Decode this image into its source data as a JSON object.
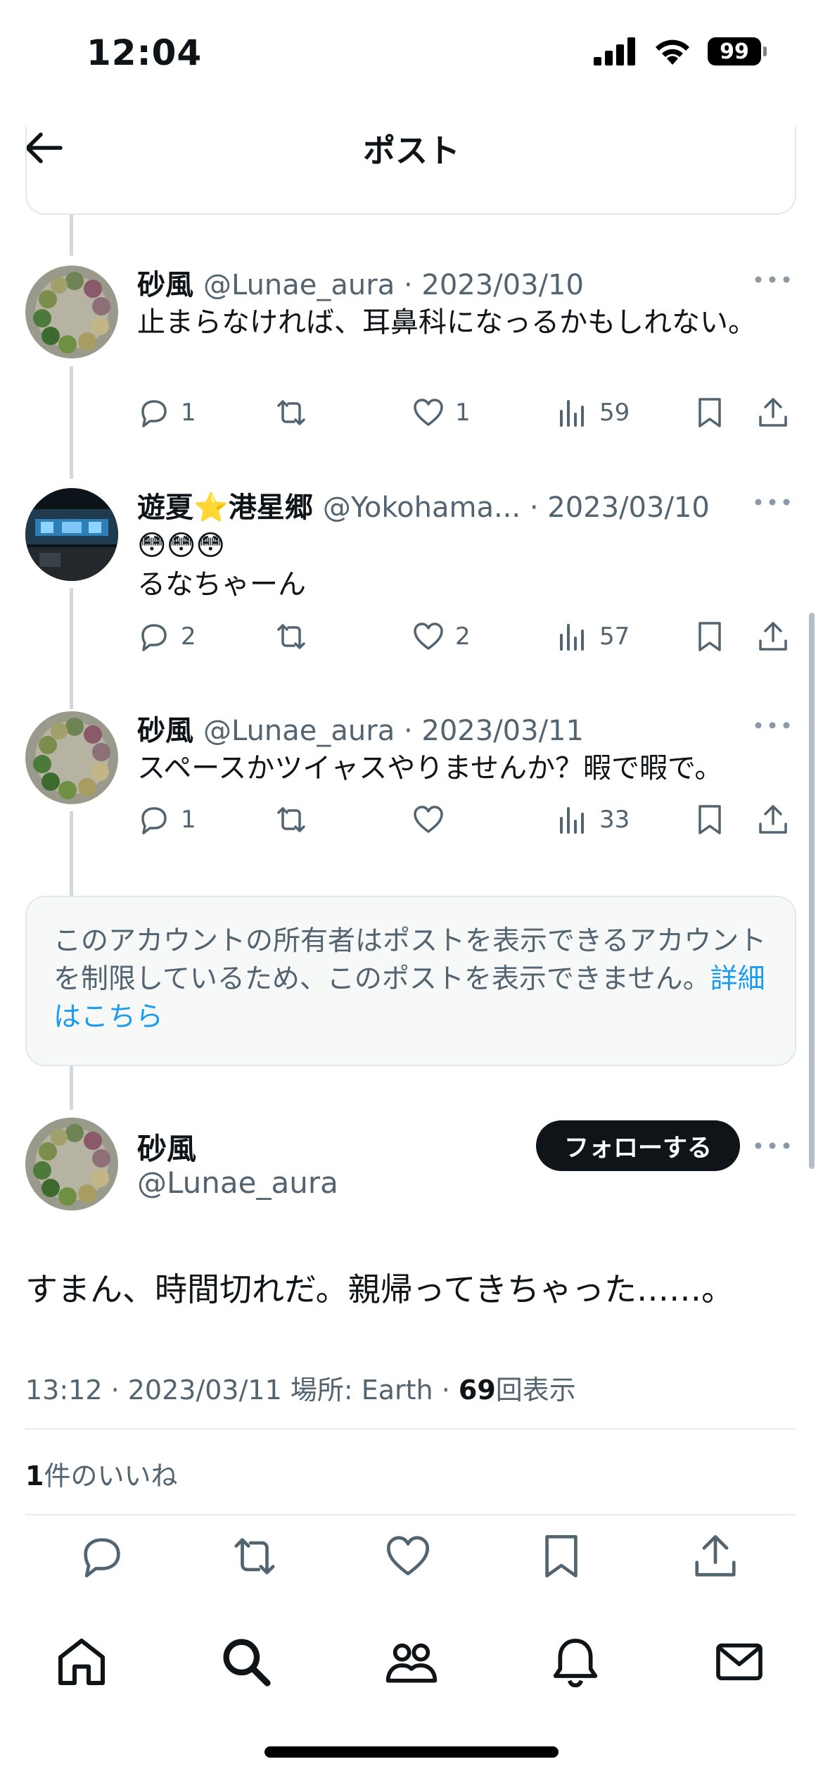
{
  "status_bar": {
    "time": "12:04",
    "battery": "99"
  },
  "header": {
    "title": "ポスト"
  },
  "tweets": [
    {
      "name": "砂風",
      "handle": "@Lunae_aura",
      "date": "2023/03/10",
      "text": "止まらなければ、耳鼻科になっるかもしれない。",
      "replies": "1",
      "retweets": "",
      "likes": "1",
      "views": "59"
    },
    {
      "name": "遊夏⭐️港星郷",
      "handle": "@Yokohama...",
      "date": "2023/03/10",
      "emoji": "😳😳😳",
      "text": "るなちゃーん",
      "replies": "2",
      "retweets": "",
      "likes": "2",
      "views": "57"
    },
    {
      "name": "砂風",
      "handle": "@Lunae_aura",
      "date": "2023/03/11",
      "text": "スペースかツイャスやりませんか？暇で暇で。",
      "replies": "1",
      "retweets": "",
      "likes": "",
      "views": "33"
    }
  ],
  "restricted_notice": {
    "text": "このアカウントの所有者はポストを表示できるアカウントを制限しているため、このポストを表示できません。",
    "link": "詳細はこちら"
  },
  "main_post": {
    "name": "砂風",
    "handle": "@Lunae_aura",
    "follow_label": "フォローする",
    "text": "すまん、時間切れだ。親帰ってきちゃった……。",
    "time": "13:12 · 2023/03/11 場所: Earth · ",
    "views_count": "69",
    "views_label": "回表示",
    "likes_count": "1",
    "likes_label": "件のいいね"
  },
  "tabbar": {
    "items": [
      "home-icon",
      "search-icon",
      "communities-icon",
      "notifications-icon",
      "messages-icon"
    ]
  },
  "colors": {
    "text": "#0f1419",
    "secondary": "#536471",
    "link": "#1d9bf0",
    "border": "#e1e8ed"
  }
}
